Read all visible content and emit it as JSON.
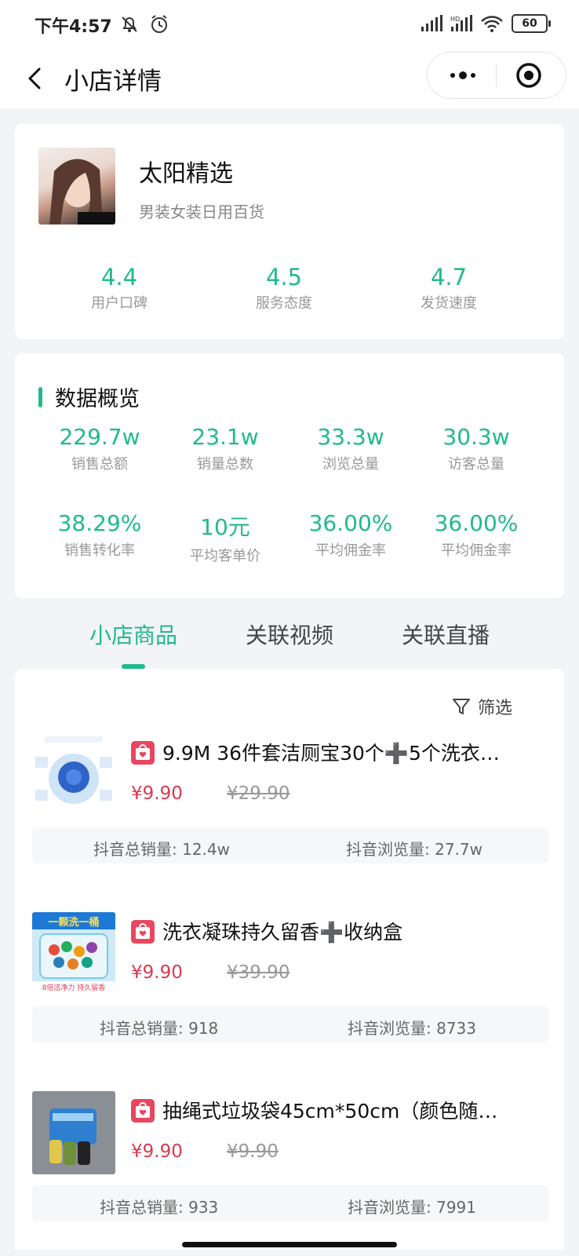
{
  "status": {
    "time": "下午4:57",
    "battery": "60"
  },
  "nav": {
    "title": "小店详情"
  },
  "shop": {
    "name": "太阳精选",
    "category": "男装女装日用百货",
    "scores": [
      {
        "value": "4.4",
        "label": "用户口碑"
      },
      {
        "value": "4.5",
        "label": "服务态度"
      },
      {
        "value": "4.7",
        "label": "发货速度"
      }
    ]
  },
  "overview": {
    "title": "数据概览",
    "metrics": [
      {
        "value": "229.7w",
        "label": "销售总额"
      },
      {
        "value": "23.1w",
        "label": "销量总数"
      },
      {
        "value": "33.3w",
        "label": "浏览总量"
      },
      {
        "value": "30.3w",
        "label": "访客总量"
      },
      {
        "value": "38.29%",
        "label": "销售转化率"
      },
      {
        "value": "10元",
        "label": "平均客单价"
      },
      {
        "value": "36.00%",
        "label": "平均佣金率"
      },
      {
        "value": "36.00%",
        "label": "平均佣金率"
      }
    ]
  },
  "tabs": [
    "小店商品",
    "关联视频",
    "关联直播"
  ],
  "filter": {
    "label": "筛选"
  },
  "products": [
    {
      "title": "9.9M 36件套洁厕宝30个➕5个洗衣…",
      "price": "¥9.90",
      "old_price": "¥29.90",
      "sales": "抖音总销量: 12.4w",
      "views": "抖音浏览量: 27.7w"
    },
    {
      "title": "洗衣凝珠持久留香➕收纳盒",
      "price": "¥9.90",
      "old_price": "¥39.90",
      "sales": "抖音总销量: 918",
      "views": "抖音浏览量: 8733",
      "thumb_text_top": "一颗洗一桶",
      "thumb_text_bottom": "8倍洁净力 持久留香"
    },
    {
      "title": "抽绳式垃圾袋45cm*50cm（颜色随…",
      "price": "¥9.90",
      "old_price": "¥9.90",
      "sales": "抖音总销量: 933",
      "views": "抖音浏览量: 7991"
    }
  ]
}
